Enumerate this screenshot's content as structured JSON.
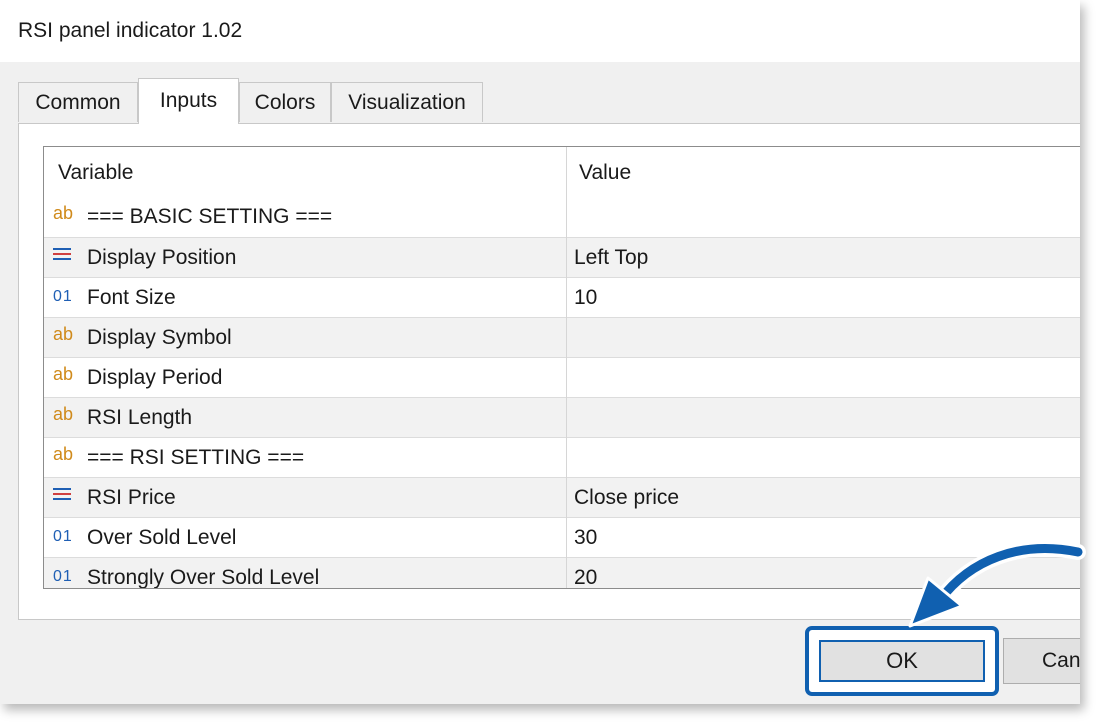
{
  "window": {
    "title": "RSI panel indicator 1.02"
  },
  "tabs": [
    {
      "label": "Common"
    },
    {
      "label": "Inputs"
    },
    {
      "label": "Colors"
    },
    {
      "label": "Visualization"
    }
  ],
  "active_tab": "Inputs",
  "table": {
    "columns": [
      "Variable",
      "Value"
    ],
    "rows": [
      {
        "icon": "string-ab-icon",
        "name": "=== BASIC SETTING ===",
        "value": ""
      },
      {
        "icon": "enum-list-icon",
        "name": "Display Position",
        "value": "Left Top"
      },
      {
        "icon": "integer-01-icon",
        "name": "Font Size",
        "value": "10"
      },
      {
        "icon": "string-ab-icon",
        "name": "Display Symbol",
        "value": ""
      },
      {
        "icon": "string-ab-icon",
        "name": "Display Period",
        "value": ""
      },
      {
        "icon": "string-ab-icon",
        "name": "RSI Length",
        "value": ""
      },
      {
        "icon": "string-ab-icon",
        "name": "=== RSI SETTING ===",
        "value": ""
      },
      {
        "icon": "enum-list-icon",
        "name": "RSI Price",
        "value": "Close price"
      },
      {
        "icon": "integer-01-icon",
        "name": "Over Sold Level",
        "value": "30"
      },
      {
        "icon": "integer-01-icon",
        "name": "Strongly Over Sold Level",
        "value": "20"
      }
    ]
  },
  "icon_glyphs": {
    "string": "ab",
    "integer": "01"
  },
  "buttons": {
    "ok": "OK",
    "cancel_partial": "Can"
  },
  "colors": {
    "accent_blue": "#1060b0",
    "string_icon": "#d08a1a",
    "integer_icon": "#1f5fb4"
  }
}
